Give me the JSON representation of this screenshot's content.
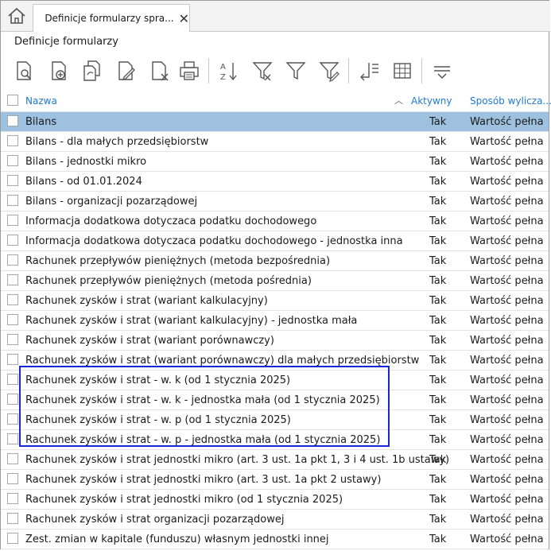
{
  "tab": {
    "title": "Definicje formularzy spra..."
  },
  "section_title": "Definicje formularzy",
  "columns": {
    "name": "Nazwa",
    "active": "Aktywny",
    "method": "Sposób wylicza..."
  },
  "rows": [
    {
      "name": "Bilans",
      "active": "Tak",
      "method": "Wartość pełna"
    },
    {
      "name": "Bilans - dla małych przedsiębiorstw",
      "active": "Tak",
      "method": "Wartość pełna"
    },
    {
      "name": "Bilans - jednostki mikro",
      "active": "Tak",
      "method": "Wartość pełna"
    },
    {
      "name": "Bilans - od 01.01.2024",
      "active": "Tak",
      "method": "Wartość pełna"
    },
    {
      "name": "Bilans - organizacji pozarządowej",
      "active": "Tak",
      "method": "Wartość pełna"
    },
    {
      "name": "Informacja dodatkowa dotyczaca podatku dochodowego",
      "active": "Tak",
      "method": "Wartość pełna"
    },
    {
      "name": "Informacja dodatkowa dotyczaca podatku dochodowego - jednostka inna",
      "active": "Tak",
      "method": "Wartość pełna"
    },
    {
      "name": "Rachunek przepływów pieniężnych (metoda bezpośrednia)",
      "active": "Tak",
      "method": "Wartość pełna"
    },
    {
      "name": "Rachunek przepływów pieniężnych (metoda pośrednia)",
      "active": "Tak",
      "method": "Wartość pełna"
    },
    {
      "name": "Rachunek zysków i strat (wariant kalkulacyjny)",
      "active": "Tak",
      "method": "Wartość pełna"
    },
    {
      "name": "Rachunek zysków i strat (wariant kalkulacyjny) - jednostka mała",
      "active": "Tak",
      "method": "Wartość pełna"
    },
    {
      "name": "Rachunek zysków i strat (wariant porównawczy)",
      "active": "Tak",
      "method": "Wartość pełna"
    },
    {
      "name": "Rachunek zysków i strat (wariant porównawczy) dla małych przedsiębiorstw",
      "active": "Tak",
      "method": "Wartość pełna"
    },
    {
      "name": "Rachunek zysków i strat - w. k (od 1 stycznia 2025)",
      "active": "Tak",
      "method": "Wartość pełna"
    },
    {
      "name": "Rachunek zysków i strat - w. k - jednostka mała (od 1 stycznia 2025)",
      "active": "Tak",
      "method": "Wartość pełna"
    },
    {
      "name": "Rachunek zysków i strat - w. p (od 1 stycznia 2025)",
      "active": "Tak",
      "method": "Wartość pełna"
    },
    {
      "name": "Rachunek zysków i strat - w. p - jednostka mała (od 1 stycznia 2025)",
      "active": "Tak",
      "method": "Wartość pełna"
    },
    {
      "name": "Rachunek zysków i strat jednostki mikro (art. 3 ust. 1a pkt 1, 3 i 4 ust. 1b ustawy)",
      "active": "Tak",
      "method": "Wartość pełna"
    },
    {
      "name": "Rachunek zysków i strat jednostki mikro (art. 3 ust. 1a pkt 2 ustawy)",
      "active": "Tak",
      "method": "Wartość pełna"
    },
    {
      "name": "Rachunek zysków i strat jednostki mikro (od 1 stycznia 2025)",
      "active": "Tak",
      "method": "Wartość pełna"
    },
    {
      "name": "Rachunek zysków i strat organizacji pozarządowej",
      "active": "Tak",
      "method": "Wartość pełna"
    },
    {
      "name": "Zest. zmian w kapitale (funduszu) własnym jednostki innej",
      "active": "Tak",
      "method": "Wartość pełna"
    }
  ],
  "colors": {
    "selected_row": "#9fc1e0",
    "header_text": "#1f7ad1",
    "highlight_box": "#1428d6"
  },
  "icons": [
    "home-icon",
    "form-list-icon",
    "close-icon",
    "preview-icon",
    "add-icon",
    "copy-icon",
    "edit-icon",
    "delete-icon",
    "print-icon",
    "sort-az-icon",
    "filter-icon",
    "filter-clear-icon",
    "filter-edit-icon",
    "columns-icon",
    "grid-icon",
    "menu-icon",
    "sort-up-icon"
  ]
}
